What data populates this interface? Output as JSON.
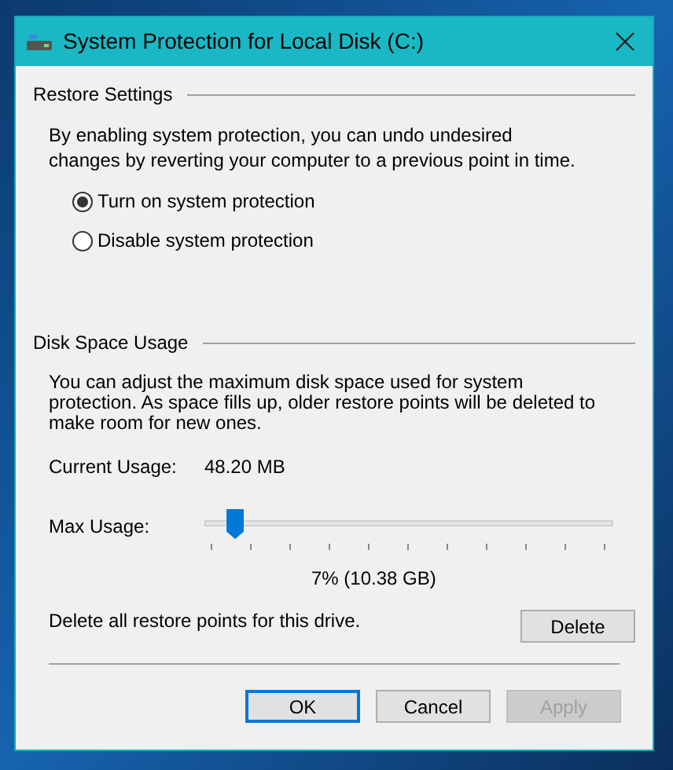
{
  "window": {
    "title": "System Protection for Local Disk (C:)"
  },
  "restore_settings": {
    "heading": "Restore Settings",
    "description": "By enabling system protection, you can undo undesired changes by reverting your computer to a previous point in time.",
    "options": [
      {
        "label": "Turn on system protection",
        "selected": true
      },
      {
        "label": "Disable system protection",
        "selected": false
      }
    ]
  },
  "disk_space_usage": {
    "heading": "Disk Space Usage",
    "description": "You can adjust the maximum disk space used for system protection. As space fills up, older restore points will be deleted to make room for new ones.",
    "current_usage_label": "Current Usage:",
    "current_usage_value": "48.20 MB",
    "max_usage_label": "Max Usage:",
    "max_usage": {
      "level": 0.07,
      "reading": "7% (10.38 GB)"
    },
    "delete_text": "Delete all restore points for this drive.",
    "delete_button": {
      "label": "Delete",
      "disabled": false
    }
  },
  "buttons": [
    {
      "label": "OK",
      "default": true,
      "disabled": false
    },
    {
      "label": "Cancel",
      "default": false,
      "disabled": false
    },
    {
      "label": "Apply",
      "default": false,
      "disabled": true
    }
  ]
}
